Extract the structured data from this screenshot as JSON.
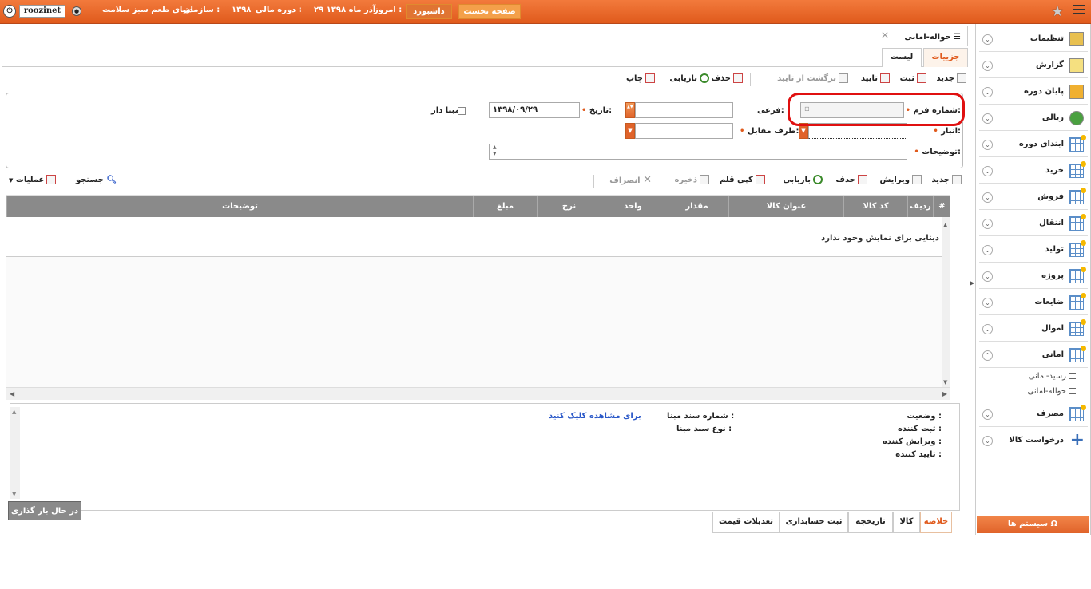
{
  "topbar": {
    "username": "roozinet",
    "power_icon": "power-icon",
    "org_label": "سازمان :",
    "org_value": "دنیای طعم سبز سلامت",
    "fiscal_label": "دوره مالی :",
    "fiscal_value": "۱۳۹۸",
    "today_label": "امروز :",
    "today_value": "۲۹ آذر ماه ۱۳۹۸",
    "dashboard": "داشبورد",
    "home": "صفحه نخست"
  },
  "sidebar": {
    "items": [
      {
        "label": "تنظیمات",
        "icon": "settings-folder-icon"
      },
      {
        "label": "گزارش",
        "icon": "report-icon"
      },
      {
        "label": "پایان دوره",
        "icon": "period-end-icon"
      },
      {
        "label": "ریالی",
        "icon": "money-icon"
      },
      {
        "label": "ابتدای دوره",
        "icon": "grid-icon"
      },
      {
        "label": "خرید",
        "icon": "grid-icon"
      },
      {
        "label": "فروش",
        "icon": "grid-icon"
      },
      {
        "label": "انتقال",
        "icon": "grid-icon"
      },
      {
        "label": "تولید",
        "icon": "grid-icon"
      },
      {
        "label": "پروژه",
        "icon": "grid-icon"
      },
      {
        "label": "ضایعات",
        "icon": "grid-icon"
      },
      {
        "label": "اموال",
        "icon": "grid-icon"
      },
      {
        "label": "امانی",
        "icon": "grid-icon"
      }
    ],
    "sub_items": [
      "رسید-امانی",
      "حواله-امانی"
    ],
    "after_items": [
      {
        "label": "مصرف",
        "icon": "grid-icon"
      },
      {
        "label": "درخواست کالا",
        "icon": "plus-icon"
      }
    ],
    "systems_button": "سیستم ها"
  },
  "page": {
    "title": "حواله-امانی",
    "tabs": [
      "جزییات",
      "لیست"
    ]
  },
  "toolbar1": {
    "new": "جدید",
    "save": "ثبت",
    "approve": "تایید",
    "unapprove": "برگشت از تایید",
    "delete": "حذف",
    "refresh": "بازیابی",
    "print": "چاپ"
  },
  "form": {
    "form_no_label": "شماره فرم:",
    "sub_label": "فرعی:",
    "date_label": "تاریخ:",
    "date_value": "۱۳۹۸/۰۹/۲۹",
    "has_base_label": "مبنا دار",
    "warehouse_label": "انبار:",
    "counterparty_label": "طرف مقابل:",
    "desc_label": "توضیحات:"
  },
  "toolbar2": {
    "new": "جدید",
    "edit": "ویرایش",
    "delete": "حذف",
    "refresh": "بازیابی",
    "copy": "کپی قلم",
    "save": "ذخیره",
    "cancel": "انصراف",
    "search": "جستجو",
    "operations": "عملیات"
  },
  "grid": {
    "columns": [
      "#",
      "ردیف",
      "کد کالا",
      "عنوان کالا",
      "مقدار",
      "واحد",
      "نرخ",
      "مبلغ",
      "توضیحات"
    ],
    "empty_message": "دیتایی برای نمایش وجود ندارد"
  },
  "details": {
    "status_label": "وضعیت :",
    "creator_label": "ثبت کننده :",
    "editor_label": "ویرایش کننده :",
    "approver_label": "تایید کننده :",
    "base_doc_no_label": "شماره سند مبنا :",
    "base_doc_type_label": "نوع سند مبنا :",
    "view_link": "برای مشاهده کلیک کنید",
    "loading": "در حال بار گذاری ..."
  },
  "bottom_tabs": [
    "خلاصه",
    "کالا",
    "تاریخچه",
    "ثبت حسابداری",
    "تعدیلات قیمت"
  ]
}
